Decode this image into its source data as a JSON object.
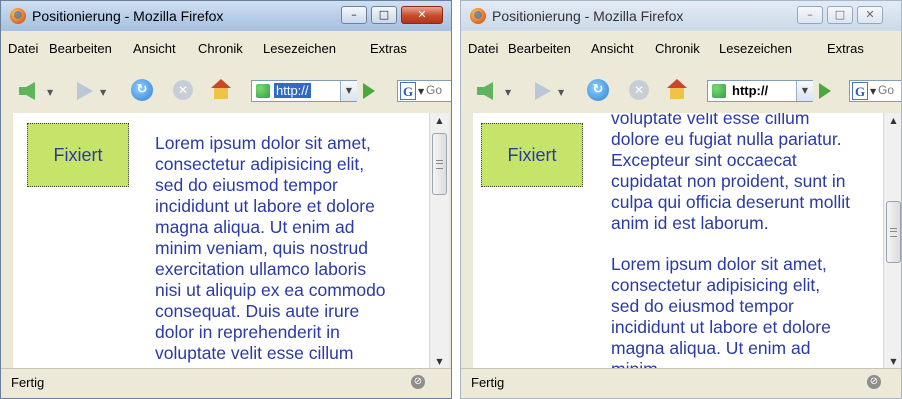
{
  "windows": [
    {
      "title": "Positionierung - Mozilla Firefox",
      "caption_buttons": {
        "minimize": "–",
        "maximize": "□",
        "close": "✕"
      },
      "menu": [
        "Datei",
        "Bearbeiten",
        "Ansicht",
        "Chronik",
        "Lesezeichen",
        "Extras"
      ],
      "url": "http://",
      "search_value": "Go",
      "fixed_box_label": "Fixiert",
      "paragraphs": [
        "Lorem ipsum dolor sit amet, consectetur adipisicing elit, sed do eiusmod tempor incididunt ut labore et dolore magna aliqua. Ut enim ad minim veniam, quis nostrud exercitation ullamco laboris nisi ut aliquip ex ea commodo consequat. Duis aute irure dolor in reprehenderit in voluptate velit esse cillum"
      ],
      "status": "Fertig"
    },
    {
      "title": "Positionierung - Mozilla Firefox",
      "caption_buttons": {
        "minimize": "–",
        "maximize": "□",
        "close": "✕"
      },
      "menu": [
        "Datei",
        "Bearbeiten",
        "Ansicht",
        "Chronik",
        "Lesezeichen",
        "Extras"
      ],
      "url": "http://",
      "search_value": "Go",
      "fixed_box_label": "Fixiert",
      "paragraphs": [
        "voluptate velit esse cillum dolore eu fugiat nulla pariatur. Excepteur sint occaecat cupidatat non proident, sunt in culpa qui officia deserunt mollit anim id est laborum.",
        "Lorem ipsum dolor sit amet, consectetur adipisicing elit, sed do eiusmod tempor incididunt ut labore et dolore magna aliqua. Ut enim ad minim"
      ],
      "status": "Fertig"
    }
  ],
  "icons": {
    "app": "firefox-icon",
    "back": "back-arrow-icon",
    "forward": "forward-arrow-icon",
    "reload": "reload-icon",
    "stop": "stop-icon",
    "home": "home-icon",
    "site": "site-favicon-icon",
    "go": "go-arrow-icon",
    "search_engine": "google-icon",
    "status": "security-status-icon"
  },
  "colors": {
    "fixed_box_bg": "#c6e46a",
    "text": "#2a3aa6",
    "url_selection": "#316ac5"
  },
  "scroll_position": [
    0.0,
    0.45
  ]
}
